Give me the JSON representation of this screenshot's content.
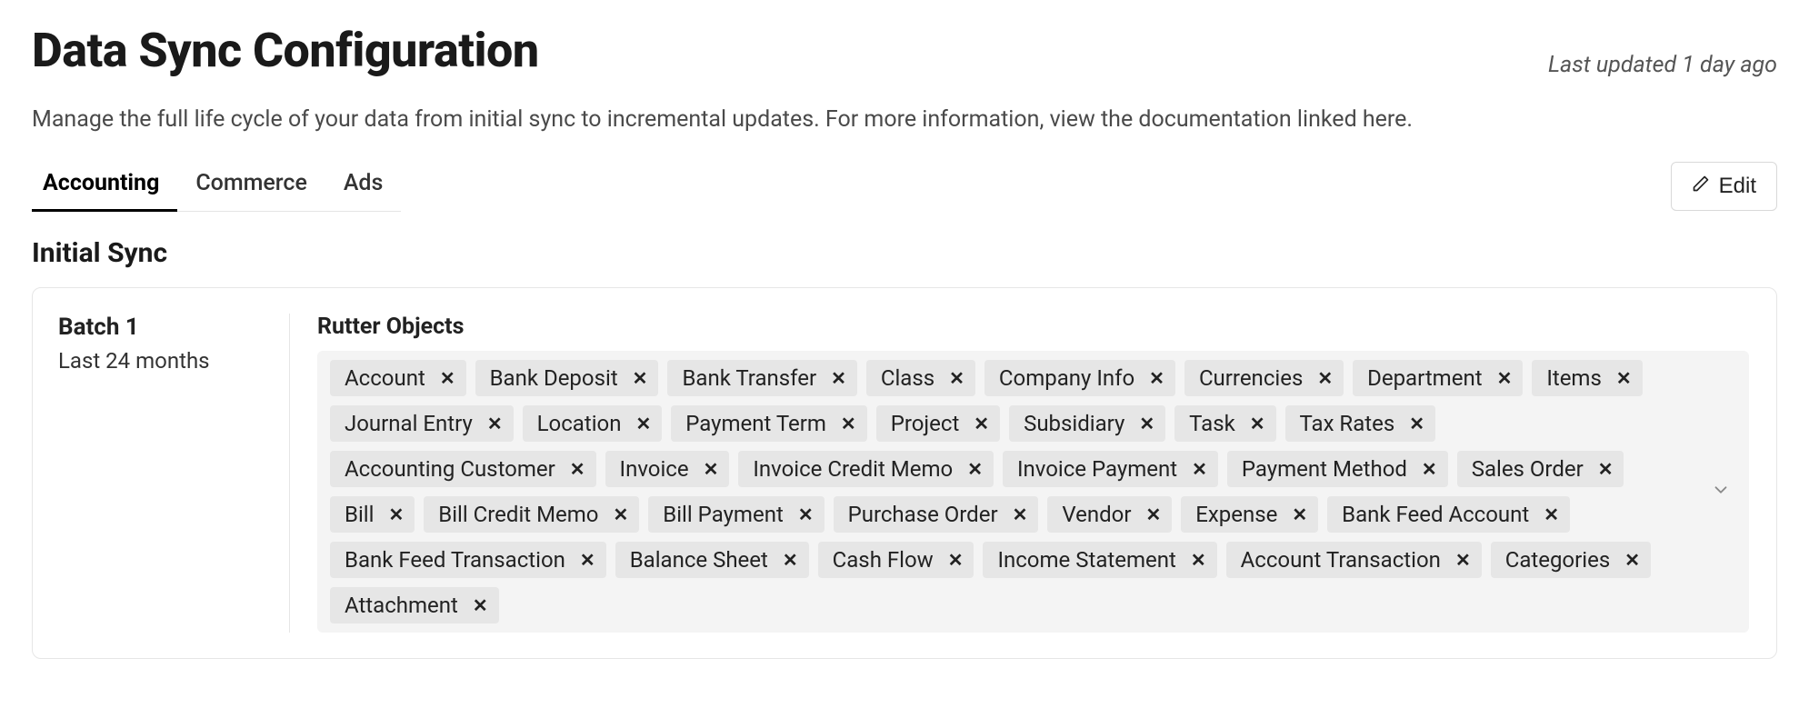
{
  "header": {
    "title": "Data Sync Configuration",
    "last_updated": "Last updated 1 day ago"
  },
  "description": "Manage the full life cycle of your data from initial sync to incremental updates. For more information, view the documentation linked here.",
  "tabs": [
    {
      "label": "Accounting",
      "active": true
    },
    {
      "label": "Commerce",
      "active": false
    },
    {
      "label": "Ads",
      "active": false
    }
  ],
  "edit_label": "Edit",
  "section_heading": "Initial Sync",
  "batch": {
    "title": "Batch 1",
    "subtitle": "Last 24 months",
    "objects_label": "Rutter Objects",
    "objects": [
      "Account",
      "Bank Deposit",
      "Bank Transfer",
      "Class",
      "Company Info",
      "Currencies",
      "Department",
      "Items",
      "Journal Entry",
      "Location",
      "Payment Term",
      "Project",
      "Subsidiary",
      "Task",
      "Tax Rates",
      "Accounting Customer",
      "Invoice",
      "Invoice Credit Memo",
      "Invoice Payment",
      "Payment Method",
      "Sales Order",
      "Bill",
      "Bill Credit Memo",
      "Bill Payment",
      "Purchase Order",
      "Vendor",
      "Expense",
      "Bank Feed Account",
      "Bank Feed Transaction",
      "Balance Sheet",
      "Cash Flow",
      "Income Statement",
      "Account Transaction",
      "Categories",
      "Attachment"
    ]
  }
}
